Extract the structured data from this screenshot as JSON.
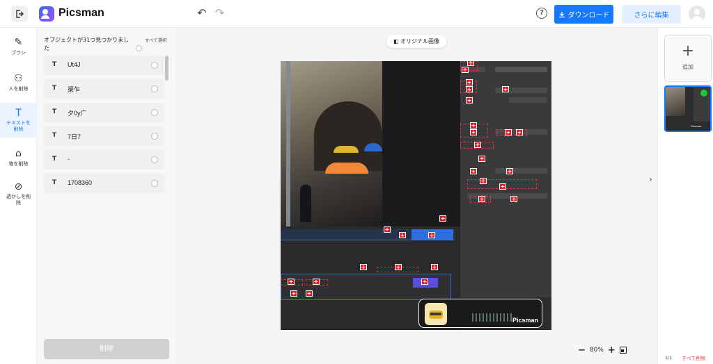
{
  "app": {
    "name": "Picsman"
  },
  "header": {
    "download_label": "ダウンロード",
    "more_edit_label": "さらに編集",
    "help_symbol": "?"
  },
  "tools": [
    {
      "label": "ブラシ",
      "icon": "brush-icon"
    },
    {
      "label": "人を削除",
      "icon": "person-icon"
    },
    {
      "label": "テキストを削除",
      "icon": "text-icon",
      "active": true
    },
    {
      "label": "物を削除",
      "icon": "bag-icon"
    },
    {
      "label": "透かしを削除",
      "icon": "watermark-icon"
    }
  ],
  "panel": {
    "title": "オブジェクトが31つ見つかりました",
    "select_all": "すべて選択",
    "items": [
      {
        "type": "T",
        "text": "Ut4J"
      },
      {
        "type": "T",
        "text": "渠乍"
      },
      {
        "type": "T",
        "text": "夕0y广"
      },
      {
        "type": "T",
        "text": "7日7"
      },
      {
        "type": "T",
        "text": "-"
      },
      {
        "type": "T",
        "text": "1708360"
      }
    ],
    "delete_label": "削除"
  },
  "canvas": {
    "original_image_label": "オリジナル画像",
    "watermark_text": "Picsman",
    "zoom_label": "80%"
  },
  "right_rail": {
    "add_label": "追加",
    "thumb_label": "Picsman",
    "page_indicator": "1/1",
    "delete_all_label": "すべて削除"
  },
  "colors": {
    "accent": "#1677ff",
    "marker": "#d8202a",
    "danger": "#e54545"
  }
}
